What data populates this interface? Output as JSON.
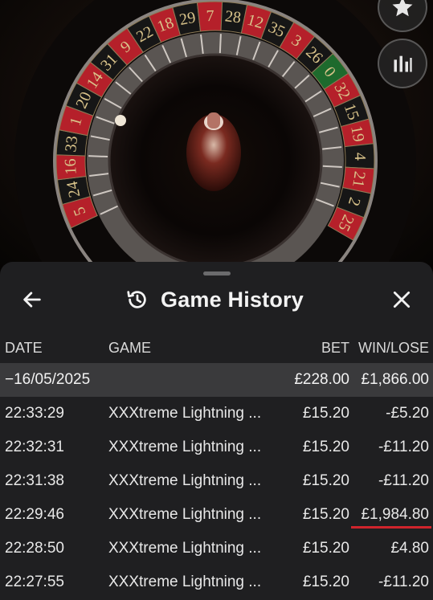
{
  "wheel": {
    "numbers_top": [
      "22",
      "18",
      "29",
      "7",
      "28",
      "12",
      "35",
      "3",
      "26",
      "0",
      "32",
      "15",
      "19",
      "4",
      "21",
      "2",
      "25"
    ],
    "numbers_left": [
      "9",
      "31",
      "14",
      "20",
      "1",
      "33",
      "16",
      "24",
      "5"
    ],
    "colors": {
      "red": "#b5202a",
      "black": "#161616",
      "green": "#1e6a2d",
      "gold": "#d9c38a"
    }
  },
  "side_buttons": {
    "favorite_icon": "star-icon",
    "stats_icon": "bar-chart-icon"
  },
  "panel": {
    "title": "Game History",
    "back_icon": "arrow-left-icon",
    "history_icon": "history-icon",
    "close_icon": "close-icon"
  },
  "table": {
    "headers": {
      "date": "DATE",
      "game": "GAME",
      "bet": "BET",
      "win": "WIN/LOSE"
    },
    "day": {
      "date": "−16/05/2025",
      "bet": "£228.00",
      "win": "£1,866.00"
    },
    "rows": [
      {
        "time": "22:33:29",
        "game": "XXXtreme Lightning ...",
        "bet": "£15.20",
        "win": "-£5.20"
      },
      {
        "time": "22:32:31",
        "game": "XXXtreme Lightning ...",
        "bet": "£15.20",
        "win": "-£11.20"
      },
      {
        "time": "22:31:38",
        "game": "XXXtreme Lightning ...",
        "bet": "£15.20",
        "win": "-£11.20"
      },
      {
        "time": "22:29:46",
        "game": "XXXtreme Lightning ...",
        "bet": "£15.20",
        "win": "£1,984.80"
      },
      {
        "time": "22:28:50",
        "game": "XXXtreme Lightning ...",
        "bet": "£15.20",
        "win": "£4.80"
      },
      {
        "time": "22:27:55",
        "game": "XXXtreme Lightning ...",
        "bet": "£15.20",
        "win": "-£11.20"
      }
    ],
    "highlight_color": "#d0242c"
  }
}
